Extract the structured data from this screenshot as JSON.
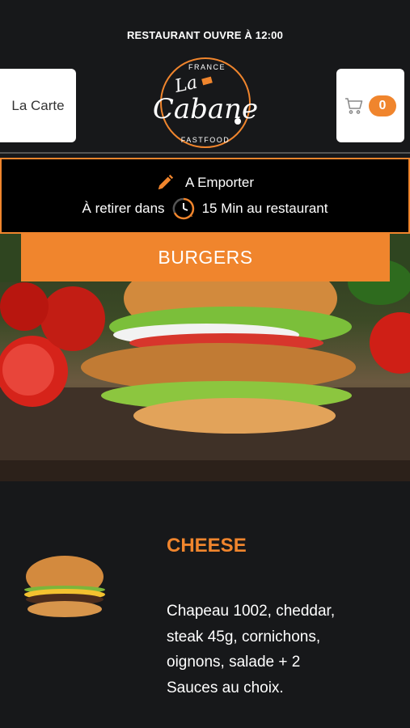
{
  "header": {
    "open_status": "RESTAURANT OUVRE À 12:00",
    "menu_label": "La Carte",
    "cart_count": "0",
    "logo": {
      "top_text": "FRANCE",
      "name_small": "La",
      "name": "Cabane",
      "bottom_text": "FASTFOOD"
    }
  },
  "order": {
    "mode": "A Emporter",
    "pickup_prefix": "À retirer dans",
    "pickup_suffix": "15 Min au restaurant"
  },
  "category": {
    "title": "BURGERS"
  },
  "product": {
    "name": "CHEESE",
    "description": "Chapeau 1002, cheddar, steak 45g, cornichons, oignons, salade  + 2 Sauces au choix."
  },
  "colors": {
    "accent": "#f0852d",
    "background": "#17181a"
  },
  "icons": {
    "cart": "cart-icon",
    "pencil": "pencil-icon",
    "clock": "clock-icon"
  }
}
